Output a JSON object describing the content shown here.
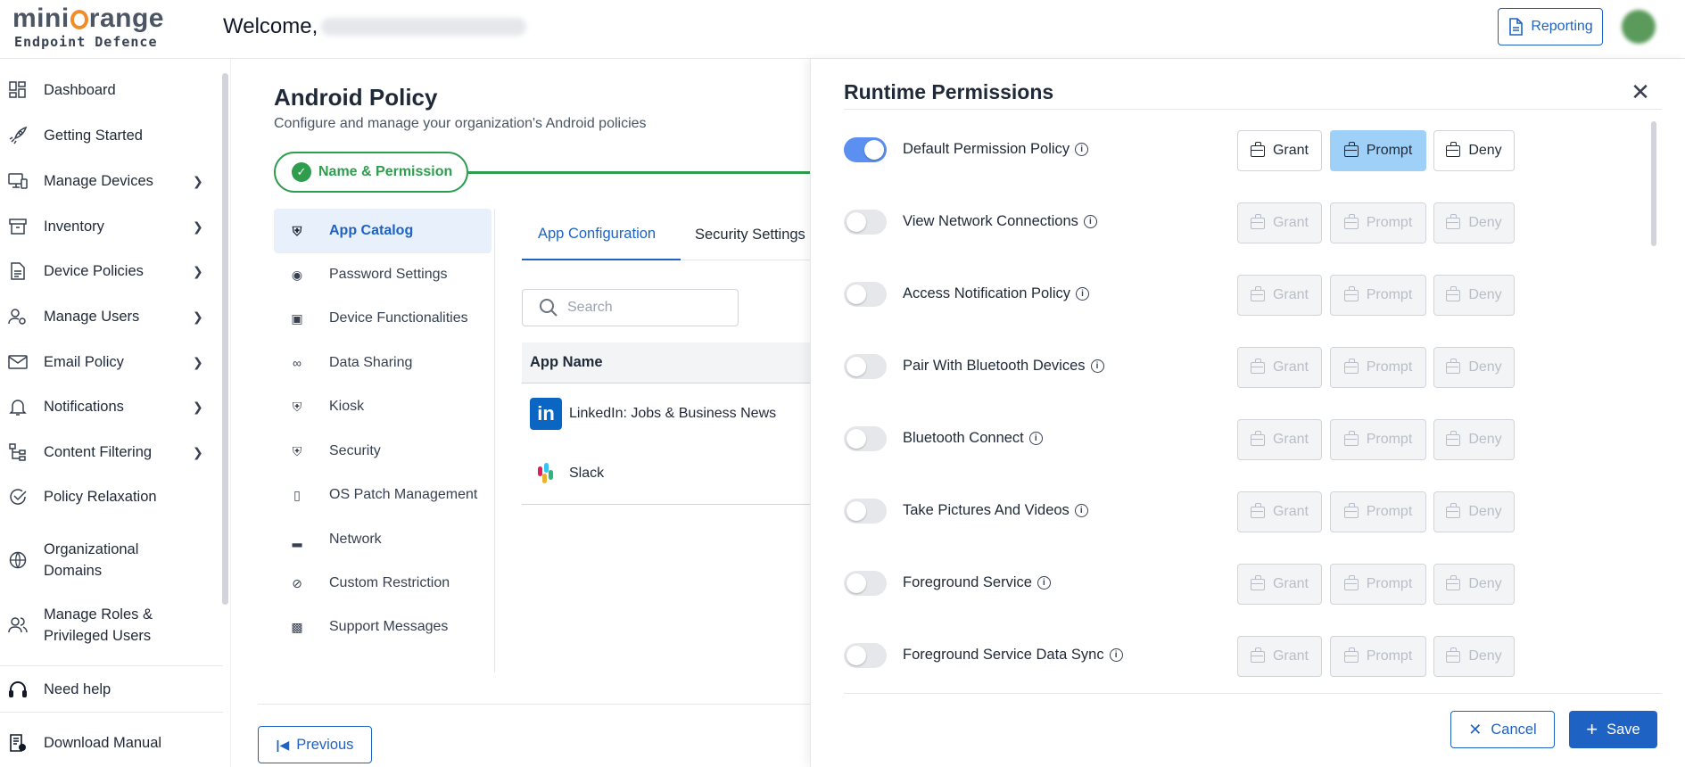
{
  "header": {
    "logo_main_left": "mini",
    "logo_main_right": "range",
    "logo_sub": "Endpoint Defence",
    "welcome": "Welcome,",
    "reporting_label": "Reporting"
  },
  "sidebar": {
    "items": [
      {
        "label": "Dashboard",
        "icon": "dashboard-icon"
      },
      {
        "label": "Getting Started",
        "icon": "rocket-icon"
      },
      {
        "label": "Manage Devices",
        "icon": "devices-icon",
        "chevron": true
      },
      {
        "label": "Inventory",
        "icon": "archive-icon",
        "chevron": true
      },
      {
        "label": "Device Policies",
        "icon": "document-icon",
        "chevron": true
      },
      {
        "label": "Manage Users",
        "icon": "user-settings-icon",
        "chevron": true
      },
      {
        "label": "Email Policy",
        "icon": "mail-icon",
        "chevron": true
      },
      {
        "label": "Notifications",
        "icon": "bell-icon",
        "chevron": true
      },
      {
        "label": "Content Filtering",
        "icon": "filter-tree-icon",
        "chevron": true
      },
      {
        "label": "Policy Relaxation",
        "icon": "check-circle-icon"
      },
      {
        "label": "Organizational Domains",
        "icon": "globe-icon"
      },
      {
        "label": "Manage Roles & Privileged Users",
        "icon": "users-icon"
      }
    ],
    "need_help": "Need help",
    "download_manual": "Download Manual"
  },
  "main": {
    "title": "Android Policy",
    "subtitle": "Configure and manage your organization's Android policies",
    "step_label": "Name & Permission",
    "subnav": [
      {
        "label": "App Catalog",
        "icon": "shield-star-icon",
        "active": true
      },
      {
        "label": "Password Settings",
        "icon": "lock-badge-icon"
      },
      {
        "label": "Device Functionalities",
        "icon": "laptop-phone-icon"
      },
      {
        "label": "Data Sharing",
        "icon": "share-icon"
      },
      {
        "label": "Kiosk",
        "icon": "shield-star-icon"
      },
      {
        "label": "Security",
        "icon": "shield-icon"
      },
      {
        "label": "OS Patch Management",
        "icon": "phone-patch-icon"
      },
      {
        "label": "Network",
        "icon": "signal-icon"
      },
      {
        "label": "Custom Restriction",
        "icon": "block-icon"
      },
      {
        "label": "Support Messages",
        "icon": "chat-icon"
      }
    ],
    "tabs": [
      "App Configuration",
      "Security Settings"
    ],
    "search_placeholder": "Search",
    "table_header": "App Name",
    "apps": [
      "LinkedIn: Jobs & Business News",
      "Slack"
    ],
    "previous_label": "Previous"
  },
  "panel": {
    "title": "Runtime Permissions",
    "button_labels": {
      "grant": "Grant",
      "prompt": "Prompt",
      "deny": "Deny"
    },
    "permissions": [
      {
        "label": "Default Permission Policy",
        "enabled": true,
        "selected": "prompt"
      },
      {
        "label": "View Network Connections",
        "enabled": false,
        "selected": null
      },
      {
        "label": "Access Notification Policy",
        "enabled": false,
        "selected": null
      },
      {
        "label": "Pair With Bluetooth Devices",
        "enabled": false,
        "selected": null
      },
      {
        "label": "Bluetooth Connect",
        "enabled": false,
        "selected": null
      },
      {
        "label": "Take Pictures And Videos",
        "enabled": false,
        "selected": null
      },
      {
        "label": "Foreground Service",
        "enabled": false,
        "selected": null
      },
      {
        "label": "Foreground Service Data Sync",
        "enabled": false,
        "selected": null
      }
    ],
    "cancel_label": "Cancel",
    "save_label": "Save"
  },
  "colors": {
    "primary": "#1e63c4",
    "success": "#2e9d4e",
    "toggle_on": "#5b8ff0",
    "prompt_selected": "#9fd1f8",
    "logo_accent": "#f28c28"
  }
}
